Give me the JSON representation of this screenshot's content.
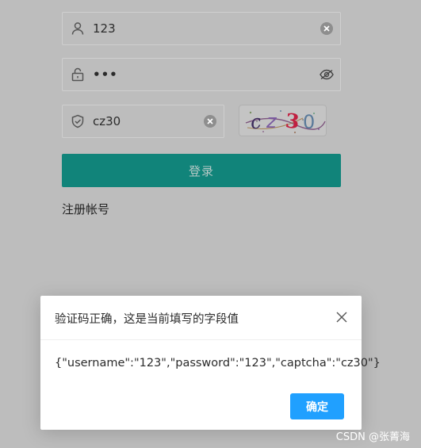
{
  "form": {
    "username": {
      "value": "123",
      "icon": "user-icon"
    },
    "password": {
      "value": "•••",
      "icon": "lock-icon"
    },
    "captcha": {
      "value": "cz30",
      "icon": "shield-icon",
      "image_text": "cz30"
    },
    "login_label": "登录",
    "register_label": "注册帐号"
  },
  "dialog": {
    "title": "验证码正确，这是当前填写的字段值",
    "body": "{\"username\":\"123\",\"password\":\"123\",\"captcha\":\"cz30\"}",
    "confirm_label": "确定"
  },
  "watermark": "CSDN @张菁海",
  "colors": {
    "overlay_bg": "#bdbdbd",
    "login_button": "#11847a",
    "confirm_button": "#20a0ff"
  }
}
